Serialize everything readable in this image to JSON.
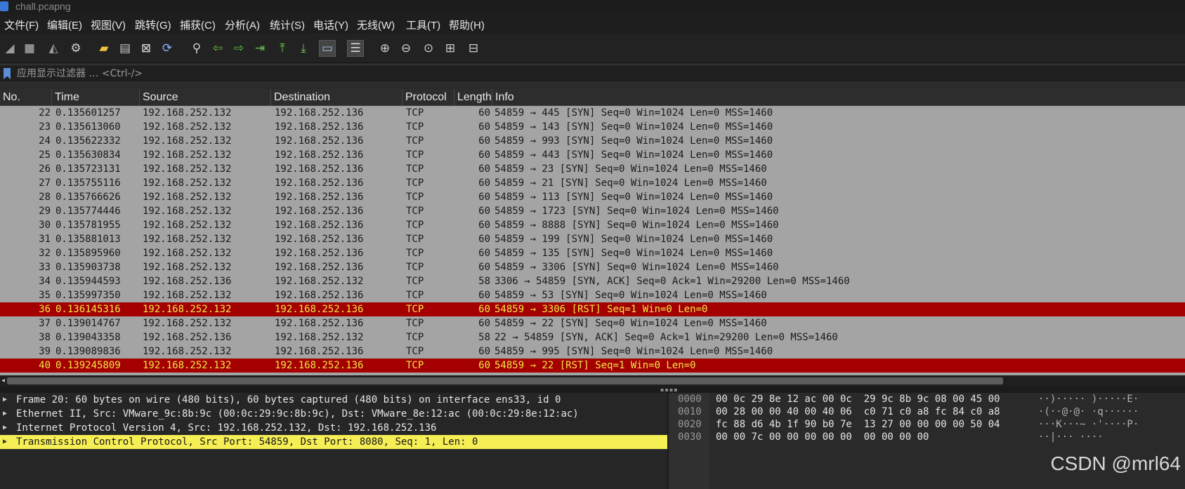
{
  "window": {
    "title": "chall.pcapng"
  },
  "menu": [
    "文件(F)",
    "编辑(E)",
    "视图(V)",
    "跳转(G)",
    "捕获(C)",
    "分析(A)",
    "统计(S)",
    "电话(Y)",
    "无线(W)",
    "工具(T)",
    "帮助(H)"
  ],
  "toolbar": [
    {
      "name": "start-capture-icon",
      "glyph": "◢",
      "color": "#9a9a9a"
    },
    {
      "name": "stop-capture-icon",
      "glyph": "■",
      "color": "#8a8a8a"
    },
    {
      "name": "restart-capture-icon",
      "glyph": "◭",
      "color": "#9a9a9a"
    },
    {
      "name": "capture-options-icon",
      "glyph": "⚙",
      "color": "#d0d0d0"
    },
    {
      "name": "open-file-icon",
      "glyph": "▰",
      "color": "#f0c040"
    },
    {
      "name": "save-file-icon",
      "glyph": "▤",
      "color": "#c8c8c8"
    },
    {
      "name": "close-file-icon",
      "glyph": "⊠",
      "color": "#e0e0e0"
    },
    {
      "name": "reload-file-icon",
      "glyph": "⟳",
      "color": "#7fb0ff"
    },
    {
      "name": "find-packet-icon",
      "glyph": "⚲",
      "color": "#d0d0d0"
    },
    {
      "name": "go-back-icon",
      "glyph": "⇦",
      "color": "#6cc24a"
    },
    {
      "name": "go-forward-icon",
      "glyph": "⇨",
      "color": "#6cc24a"
    },
    {
      "name": "go-to-packet-icon",
      "glyph": "⇥",
      "color": "#6cc24a"
    },
    {
      "name": "go-first-icon",
      "glyph": "⤒",
      "color": "#6cc24a"
    },
    {
      "name": "go-last-icon",
      "glyph": "⤓",
      "color": "#6cc24a"
    },
    {
      "name": "auto-scroll-icon",
      "glyph": "▭",
      "color": "#9fc0e8"
    },
    {
      "name": "colorize-icon",
      "glyph": "☰",
      "color": "#d8d8d8"
    },
    {
      "name": "zoom-in-icon",
      "glyph": "⊕",
      "color": "#d0d0d0"
    },
    {
      "name": "zoom-out-icon",
      "glyph": "⊖",
      "color": "#d0d0d0"
    },
    {
      "name": "zoom-reset-icon",
      "glyph": "⊙",
      "color": "#d0d0d0"
    },
    {
      "name": "resize-columns-icon",
      "glyph": "⊞",
      "color": "#d0d0d0"
    },
    {
      "name": "expand-subtrees-icon",
      "glyph": "⊟",
      "color": "#d0d0d0"
    }
  ],
  "filter": {
    "placeholder": "应用显示过滤器 … <Ctrl-/>"
  },
  "columns": [
    "No.",
    "Time",
    "Source",
    "Destination",
    "Protocol",
    "Length",
    "Info"
  ],
  "packets": [
    {
      "no": "22",
      "time": "0.135601257",
      "src": "192.168.252.132",
      "dst": "192.168.252.136",
      "proto": "TCP",
      "len": "60",
      "info": "54859 → 445 [SYN] Seq=0 Win=1024 Len=0 MSS=1460",
      "rst": false
    },
    {
      "no": "23",
      "time": "0.135613060",
      "src": "192.168.252.132",
      "dst": "192.168.252.136",
      "proto": "TCP",
      "len": "60",
      "info": "54859 → 143 [SYN] Seq=0 Win=1024 Len=0 MSS=1460",
      "rst": false
    },
    {
      "no": "24",
      "time": "0.135622332",
      "src": "192.168.252.132",
      "dst": "192.168.252.136",
      "proto": "TCP",
      "len": "60",
      "info": "54859 → 993 [SYN] Seq=0 Win=1024 Len=0 MSS=1460",
      "rst": false
    },
    {
      "no": "25",
      "time": "0.135630834",
      "src": "192.168.252.132",
      "dst": "192.168.252.136",
      "proto": "TCP",
      "len": "60",
      "info": "54859 → 443 [SYN] Seq=0 Win=1024 Len=0 MSS=1460",
      "rst": false
    },
    {
      "no": "26",
      "time": "0.135723131",
      "src": "192.168.252.132",
      "dst": "192.168.252.136",
      "proto": "TCP",
      "len": "60",
      "info": "54859 → 23 [SYN] Seq=0 Win=1024 Len=0 MSS=1460",
      "rst": false
    },
    {
      "no": "27",
      "time": "0.135755116",
      "src": "192.168.252.132",
      "dst": "192.168.252.136",
      "proto": "TCP",
      "len": "60",
      "info": "54859 → 21 [SYN] Seq=0 Win=1024 Len=0 MSS=1460",
      "rst": false
    },
    {
      "no": "28",
      "time": "0.135766626",
      "src": "192.168.252.132",
      "dst": "192.168.252.136",
      "proto": "TCP",
      "len": "60",
      "info": "54859 → 113 [SYN] Seq=0 Win=1024 Len=0 MSS=1460",
      "rst": false
    },
    {
      "no": "29",
      "time": "0.135774446",
      "src": "192.168.252.132",
      "dst": "192.168.252.136",
      "proto": "TCP",
      "len": "60",
      "info": "54859 → 1723 [SYN] Seq=0 Win=1024 Len=0 MSS=1460",
      "rst": false
    },
    {
      "no": "30",
      "time": "0.135781955",
      "src": "192.168.252.132",
      "dst": "192.168.252.136",
      "proto": "TCP",
      "len": "60",
      "info": "54859 → 8888 [SYN] Seq=0 Win=1024 Len=0 MSS=1460",
      "rst": false
    },
    {
      "no": "31",
      "time": "0.135881013",
      "src": "192.168.252.132",
      "dst": "192.168.252.136",
      "proto": "TCP",
      "len": "60",
      "info": "54859 → 199 [SYN] Seq=0 Win=1024 Len=0 MSS=1460",
      "rst": false
    },
    {
      "no": "32",
      "time": "0.135895960",
      "src": "192.168.252.132",
      "dst": "192.168.252.136",
      "proto": "TCP",
      "len": "60",
      "info": "54859 → 135 [SYN] Seq=0 Win=1024 Len=0 MSS=1460",
      "rst": false
    },
    {
      "no": "33",
      "time": "0.135903738",
      "src": "192.168.252.132",
      "dst": "192.168.252.136",
      "proto": "TCP",
      "len": "60",
      "info": "54859 → 3306 [SYN] Seq=0 Win=1024 Len=0 MSS=1460",
      "rst": false
    },
    {
      "no": "34",
      "time": "0.135944593",
      "src": "192.168.252.136",
      "dst": "192.168.252.132",
      "proto": "TCP",
      "len": "58",
      "info": "3306 → 54859 [SYN, ACK] Seq=0 Ack=1 Win=29200 Len=0 MSS=1460",
      "rst": false
    },
    {
      "no": "35",
      "time": "0.135997350",
      "src": "192.168.252.132",
      "dst": "192.168.252.136",
      "proto": "TCP",
      "len": "60",
      "info": "54859 → 53 [SYN] Seq=0 Win=1024 Len=0 MSS=1460",
      "rst": false
    },
    {
      "no": "36",
      "time": "0.136145316",
      "src": "192.168.252.132",
      "dst": "192.168.252.136",
      "proto": "TCP",
      "len": "60",
      "info": "54859 → 3306 [RST] Seq=1 Win=0 Len=0",
      "rst": true
    },
    {
      "no": "37",
      "time": "0.139014767",
      "src": "192.168.252.132",
      "dst": "192.168.252.136",
      "proto": "TCP",
      "len": "60",
      "info": "54859 → 22 [SYN] Seq=0 Win=1024 Len=0 MSS=1460",
      "rst": false
    },
    {
      "no": "38",
      "time": "0.139043358",
      "src": "192.168.252.136",
      "dst": "192.168.252.132",
      "proto": "TCP",
      "len": "58",
      "info": "22 → 54859 [SYN, ACK] Seq=0 Ack=1 Win=29200 Len=0 MSS=1460",
      "rst": false
    },
    {
      "no": "39",
      "time": "0.139089836",
      "src": "192.168.252.132",
      "dst": "192.168.252.136",
      "proto": "TCP",
      "len": "60",
      "info": "54859 → 995 [SYN] Seq=0 Win=1024 Len=0 MSS=1460",
      "rst": false
    },
    {
      "no": "40",
      "time": "0.139245809",
      "src": "192.168.252.132",
      "dst": "192.168.252.136",
      "proto": "TCP",
      "len": "60",
      "info": "54859 → 22 [RST] Seq=1 Win=0 Len=0",
      "rst": true
    }
  ],
  "details": [
    {
      "text": "Frame 20: 60 bytes on wire (480 bits), 60 bytes captured (480 bits) on interface ens33, id 0",
      "highlight": false
    },
    {
      "text": "Ethernet II, Src: VMware_9c:8b:9c (00:0c:29:9c:8b:9c), Dst: VMware_8e:12:ac (00:0c:29:8e:12:ac)",
      "highlight": false
    },
    {
      "text": "Internet Protocol Version 4, Src: 192.168.252.132, Dst: 192.168.252.136",
      "highlight": false
    },
    {
      "text": "Transmission Control Protocol, Src Port: 54859, Dst Port: 8080, Seq: 1, Len: 0",
      "highlight": true
    }
  ],
  "hex": [
    {
      "offset": "0000",
      "bytes": "00 0c 29 8e 12 ac 00 0c  29 9c 8b 9c 08 00 45 00",
      "ascii": "··)····· )·····E·"
    },
    {
      "offset": "0010",
      "bytes": "00 28 00 00 40 00 40 06  c0 71 c0 a8 fc 84 c0 a8",
      "ascii": "·(··@·@· ·q······"
    },
    {
      "offset": "0020",
      "bytes": "fc 88 d6 4b 1f 90 b0 7e  13 27 00 00 00 00 50 04",
      "ascii": "···K···~ ·'····P·"
    },
    {
      "offset": "0030",
      "bytes": "00 00 7c 00 00 00 00 00  00 00 00 00",
      "ascii": "··|··· ····"
    }
  ],
  "watermark": "CSDN @mrl64"
}
